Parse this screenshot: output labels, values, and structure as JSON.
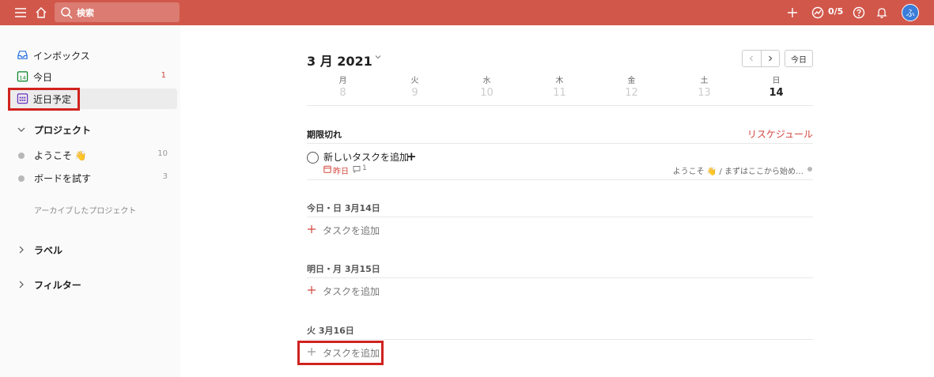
{
  "topbar": {
    "search_placeholder": "検索",
    "karma": "0/5",
    "avatar_initial": "ふ"
  },
  "sidebar": {
    "items": [
      {
        "label": "インボックス",
        "count": ""
      },
      {
        "label": "今日",
        "count": "1"
      },
      {
        "label": "近日予定",
        "count": ""
      }
    ],
    "projects_header": "プロジェクト",
    "projects": [
      {
        "label": "ようこそ 👋",
        "count": "10"
      },
      {
        "label": "ボードを試す",
        "count": "3"
      }
    ],
    "archived_label": "アーカイブしたプロジェクト",
    "labels_header": "ラベル",
    "filters_header": "フィルター"
  },
  "main": {
    "month_title": "3 月 2021",
    "today_button": "今日",
    "days": [
      {
        "name": "月",
        "date": "8"
      },
      {
        "name": "火",
        "date": "9"
      },
      {
        "name": "水",
        "date": "10"
      },
      {
        "name": "木",
        "date": "11"
      },
      {
        "name": "金",
        "date": "12"
      },
      {
        "name": "土",
        "date": "13"
      },
      {
        "name": "日",
        "date": "14"
      }
    ],
    "overdue": {
      "title": "期限切れ",
      "reschedule": "リスケジュール",
      "task": {
        "title": "新しいタスクを追加",
        "plus": "+",
        "due": "昨日",
        "comments": "1",
        "project_path": "ようこそ 👋 / まずはここから始め…"
      }
    },
    "sections": [
      {
        "title": "今日・日 3月14日",
        "add_label": "タスクを追加"
      },
      {
        "title": "明日・月 3月15日",
        "add_label": "タスクを追加"
      },
      {
        "title": "火 3月16日",
        "add_label": "タスクを追加"
      }
    ]
  },
  "colors": {
    "topbar": "#d1574a",
    "accent_red": "#d1453b",
    "highlight_box": "#d0231f"
  }
}
